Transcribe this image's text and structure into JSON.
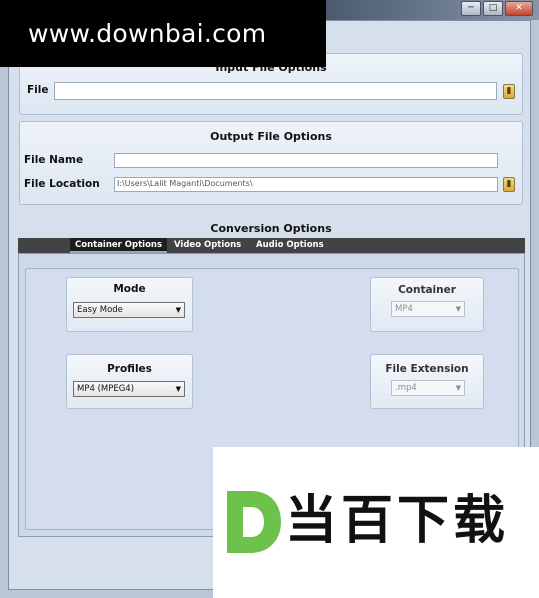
{
  "watermark": {
    "text": "www.downbai.com"
  },
  "window": {
    "min": "─",
    "max": "□",
    "close": "✕"
  },
  "input_options": {
    "title": "Input File Options",
    "file_label": "File",
    "file_value": ""
  },
  "output_options": {
    "title": "Output File Options",
    "name_label": "File Name",
    "name_value": "",
    "location_label": "File Location",
    "location_value": "I:\\Users\\Lalit Maganti\\Documents\\"
  },
  "conversion": {
    "title": "Conversion Options",
    "tabs": [
      "Container Options",
      "Video Options",
      "Audio Options"
    ],
    "active_tab": 0,
    "mode": {
      "title": "Mode",
      "value": "Easy Mode"
    },
    "profiles": {
      "title": "Profiles",
      "value": "MP4 (MPEG4)"
    },
    "container": {
      "title": "Container",
      "value": "MP4"
    },
    "extension": {
      "title": "File Extension",
      "value": ".mp4"
    }
  },
  "logo": {
    "text": "当百下载",
    "letter": "D",
    "colors": {
      "green": "#6cc24a",
      "dark": "#111111"
    }
  },
  "icons": {
    "browse": "folder-icon",
    "dropdown": "chevron-down-icon"
  }
}
